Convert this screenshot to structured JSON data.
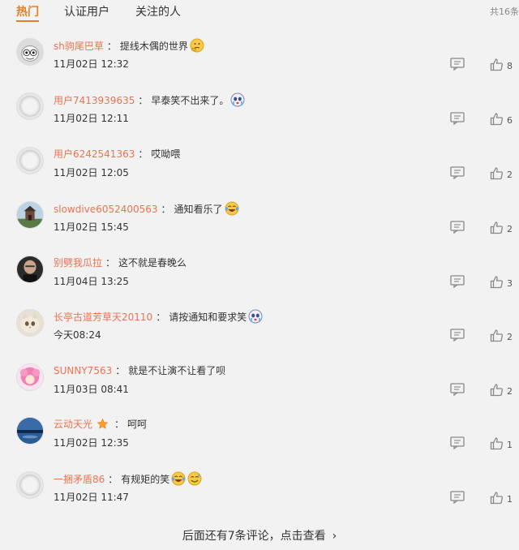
{
  "tabs": [
    {
      "label": "热门",
      "active": true
    },
    {
      "label": "认证用户",
      "active": false
    },
    {
      "label": "关注的人",
      "active": false
    }
  ],
  "total": "共16条",
  "accent_color": "#e67e22",
  "username_color": "#eb7350",
  "comments": [
    {
      "user": "sh驹尾巴草",
      "text": "提线木偶的世界",
      "emoji": [
        "thinking-emoji"
      ],
      "time": "11月02日 12:32",
      "likes": "8",
      "avatar": "sheep-avatar"
    },
    {
      "user": "用户7413939635",
      "text": "早泰笑不出来了。",
      "emoji": [
        "crying-face-emoji"
      ],
      "time": "11月02日 12:11",
      "likes": "6",
      "avatar": "default-avatar"
    },
    {
      "user": "用户6242541363",
      "text": "哎呦喂",
      "emoji": [],
      "time": "11月02日 12:05",
      "likes": "2",
      "avatar": "default-avatar"
    },
    {
      "user": "slowdive6052400563",
      "text": "通知看乐了",
      "emoji": [
        "laughing-tears-emoji"
      ],
      "time": "11月02日 15:45",
      "likes": "2",
      "avatar": "building-avatar"
    },
    {
      "user": "别劈我瓜拉",
      "text": "这不就是春晚么",
      "emoji": [],
      "time": "11月04日 13:25",
      "likes": "3",
      "avatar": "man-avatar"
    },
    {
      "user": "长亭古道芳草天20110",
      "text": "请按通知和要求笑",
      "emoji": [
        "crying-face-emoji"
      ],
      "time": "今天08:24",
      "likes": "2",
      "avatar": "cat-avatar"
    },
    {
      "user": "SUNNY7563",
      "text": "就是不让演不让看了呗",
      "emoji": [],
      "time": "11月03日 08:41",
      "likes": "2",
      "avatar": "pink-avatar"
    },
    {
      "user": "云动天光",
      "text": "呵呵",
      "emoji": [],
      "vip": true,
      "time": "11月02日 12:35",
      "likes": "1",
      "avatar": "lake-avatar"
    },
    {
      "user": "一捆矛盾86",
      "text": "有规矩的笑",
      "emoji": [
        "laughing-tears-emoji",
        "sweat-laugh-emoji"
      ],
      "time": "11月02日 11:47",
      "likes": "1",
      "avatar": "default-avatar"
    }
  ],
  "more_text": "后面还有7条评论，点击查看",
  "more_chevron": "›"
}
